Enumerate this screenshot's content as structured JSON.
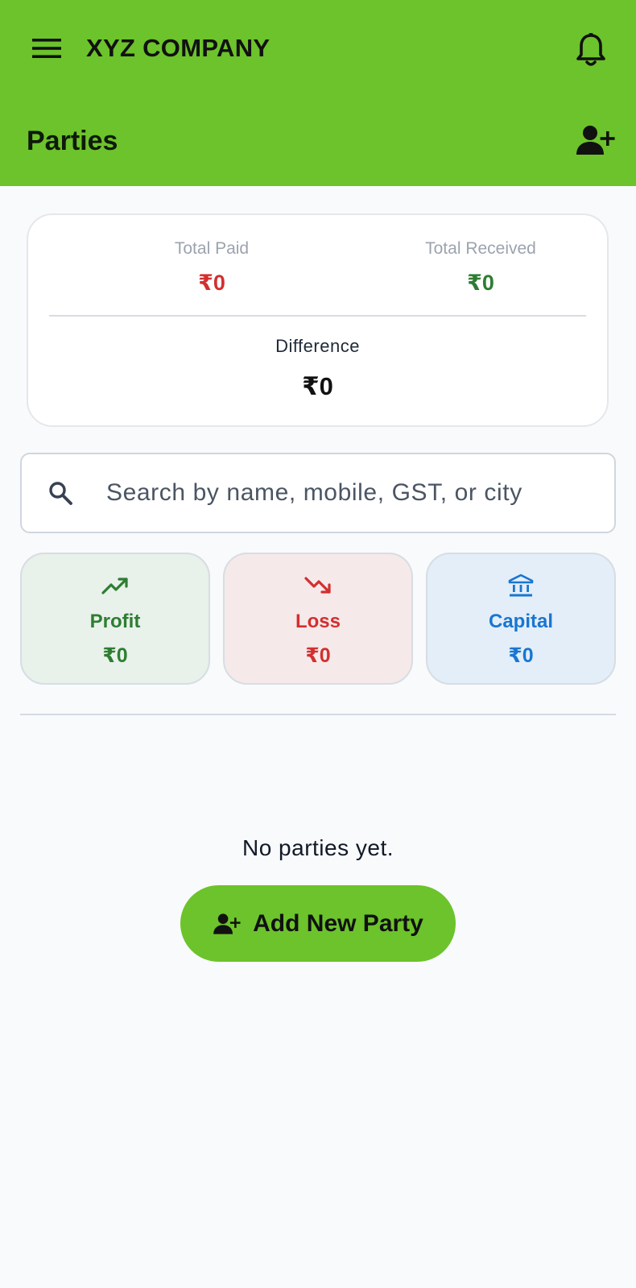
{
  "appbar": {
    "company_name": "XYZ COMPANY",
    "page_title": "Parties",
    "icons": [
      "menu-icon",
      "bell-icon",
      "add-user-icon"
    ],
    "color": "#6cc32b"
  },
  "summary": {
    "paid_label": "Total Paid",
    "paid_value": "₹0",
    "received_label": "Total Received",
    "received_value": "₹0",
    "difference_label": "Difference",
    "difference_value": "₹0"
  },
  "search": {
    "placeholder": "Search by name, mobile, GST, or city",
    "value": ""
  },
  "stats": [
    {
      "label": "Profit",
      "value": "₹0",
      "icon": "trending-up-icon",
      "color": "#2e7d32"
    },
    {
      "label": "Loss",
      "value": "₹0",
      "icon": "trending-down-icon",
      "color": "#d32f2f"
    },
    {
      "label": "Capital",
      "value": "₹0",
      "icon": "bank-icon",
      "color": "#1976d2"
    }
  ],
  "empty_state": {
    "message": "No parties yet.",
    "button_label": "Add New Party"
  }
}
